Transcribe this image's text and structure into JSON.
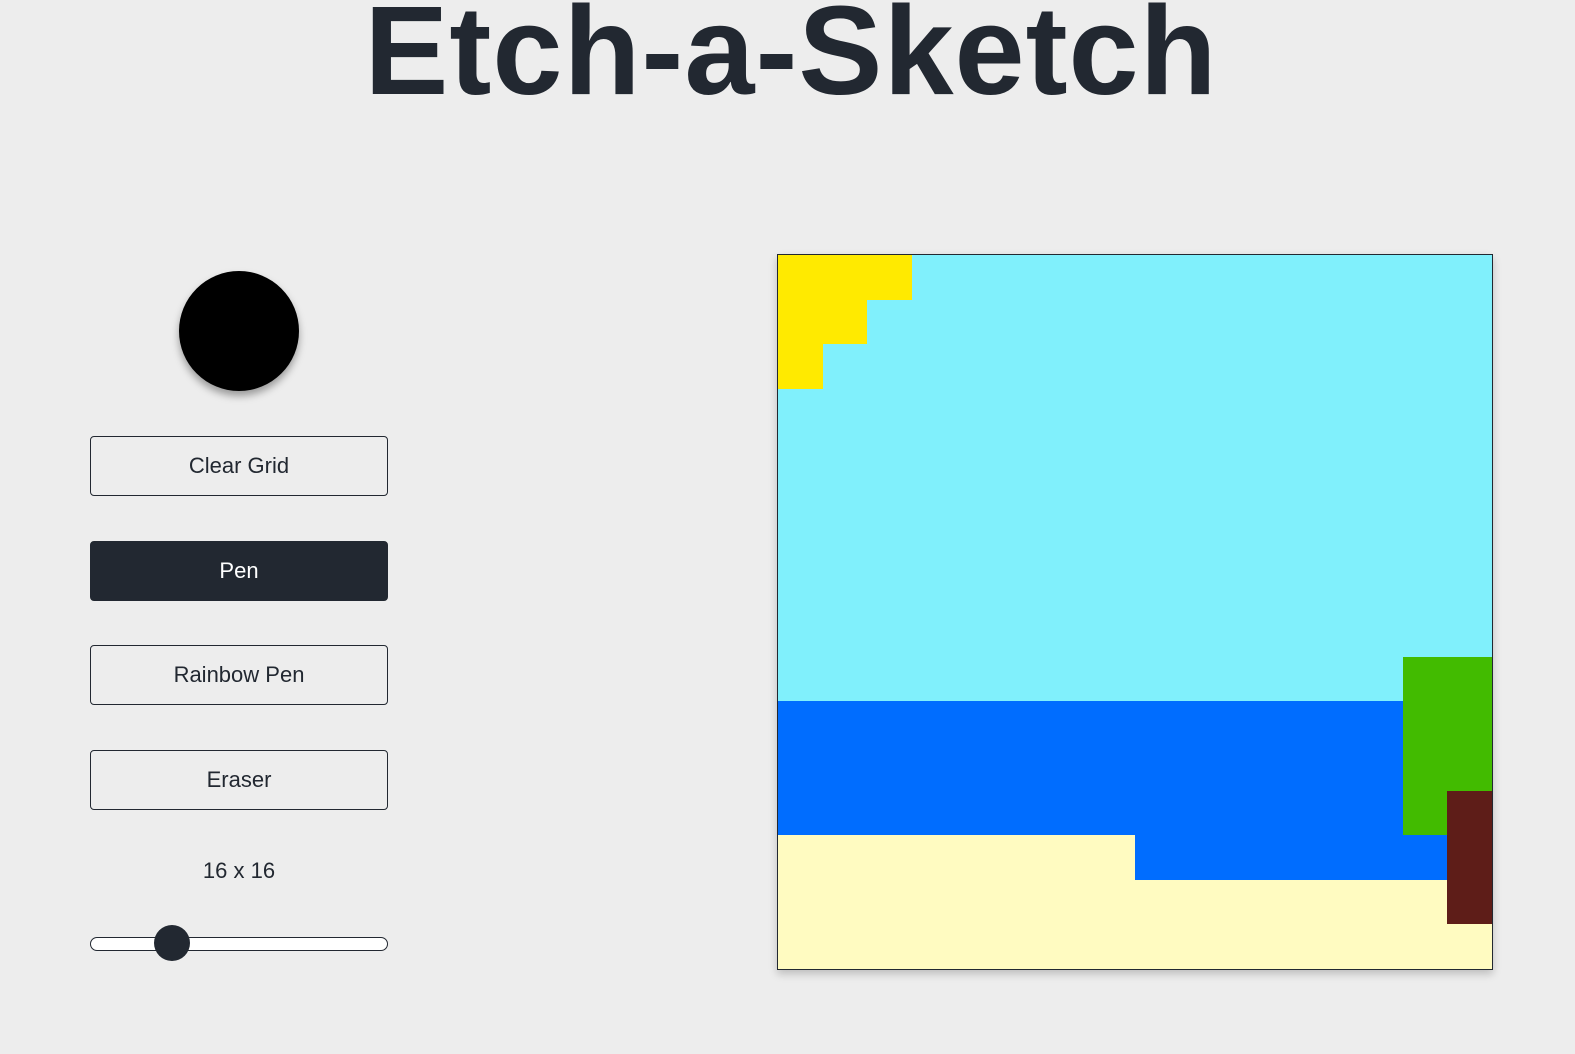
{
  "title": "Etch-a-Sketch",
  "color_picker": {
    "value": "#000000"
  },
  "buttons": {
    "clear": "Clear Grid",
    "pen": "Pen",
    "rainbow": "Rainbow Pen",
    "eraser": "Eraser"
  },
  "active_tool": "pen",
  "grid_size_label": "16 x 16",
  "slider": {
    "min": 1,
    "max": 64,
    "value": 16
  },
  "palette": {
    "s": "#80f0fc",
    "y": "#ffea00",
    "b": "#006dff",
    "g": "#42bb00",
    "t": "#5e1d18",
    "n": "#fffbc1"
  },
  "grid": {
    "size": 16,
    "rows": [
      "yyysssssssssssss",
      "yyssssssssssssss",
      "ysssssssssssssss",
      "ssssssssssssssss",
      "ssssssssssssssss",
      "ssssssssssssssss",
      "ssssssssssssssss",
      "ssssssssssssssss",
      "ssssssssssssssss",
      "ssssssssssssssgg",
      "bbbbbbbbbbbbbbgg",
      "bbbbbbbbbbbbbbgg",
      "bbbbbbbbbbbbbbgt",
      "nnnnnnnnbbbbbbbt",
      "nnnnnnnnnnnnnnnt",
      "nnnnnnnnnnnnnnnn"
    ]
  }
}
